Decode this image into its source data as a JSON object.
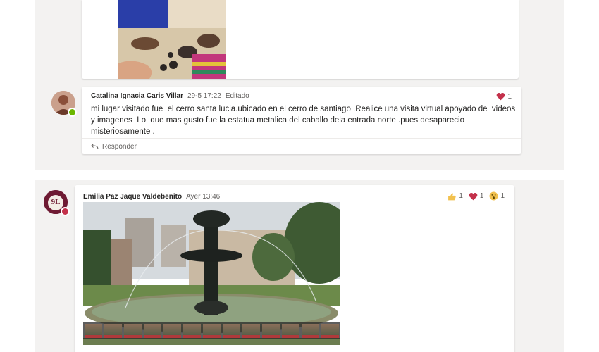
{
  "posts": [
    {
      "author": "Catalina Ignacia Caris Villar",
      "timestamp": "29-5 17:22",
      "edited": "Editado",
      "message_lines": [
        "mi lugar visitado fue  el cerro santa lucia.ubicado en el cerro de santiago .Realice una visita virtual apoyado de  videos",
        "y imagenes  Lo  que mas gusto fue la estatua metalica del caballo dela entrada norte .pues desaparecio",
        "misteriosamente ."
      ],
      "reactions": [
        {
          "icon": "heart-icon",
          "count": "1"
        }
      ],
      "reply_label": "Responder",
      "presence_color": "#6bb700"
    },
    {
      "author": "Emilia Paz Jaque Valdebenito",
      "timestamp": "Ayer 13:46",
      "reactions": [
        {
          "icon": "thumbs-up-icon",
          "count": "1"
        },
        {
          "icon": "heart-icon",
          "count": "1"
        },
        {
          "icon": "surprised-face-icon",
          "count": "1"
        }
      ],
      "avatar_text": "9L",
      "presence_color": "#c4314b"
    }
  ],
  "colors": {
    "heart": "#c4314b",
    "thumbs": "#f2c14e",
    "thread_bg": "#f3f2f1"
  }
}
